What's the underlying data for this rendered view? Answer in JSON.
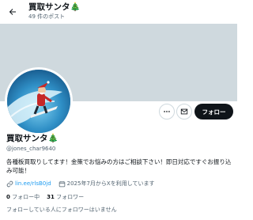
{
  "header": {
    "title": "買取サンタ",
    "title_emoji": "🎄",
    "post_count": "49 件のポスト"
  },
  "profile": {
    "name": "買取サンタ",
    "name_emoji": "🎄",
    "handle": "@jones_char9640",
    "follow_label": "フォロー",
    "more_label": "…",
    "bio": "各種板買取りしてます！金策でお悩みの方はご相談下さい！即日対応ですぐお振り込み可能！",
    "link": "lin.ee/rlsB0jd",
    "joined": "2025年7月からXを利用しています",
    "following_count": "0",
    "following_label": "フォロー中",
    "followers_count": "31",
    "followers_label": "フォロワー",
    "mutual_note": "フォローしている人にフォロワーはいません"
  },
  "icons": {
    "back": "arrow-left-icon",
    "more": "more-horizontal-icon",
    "message": "mail-icon",
    "link": "link-icon",
    "calendar": "calendar-icon"
  },
  "colors": {
    "banner": "#cfd9de",
    "follow_button": "#0f1419",
    "link": "#1d9bf0",
    "muted": "#536471"
  }
}
